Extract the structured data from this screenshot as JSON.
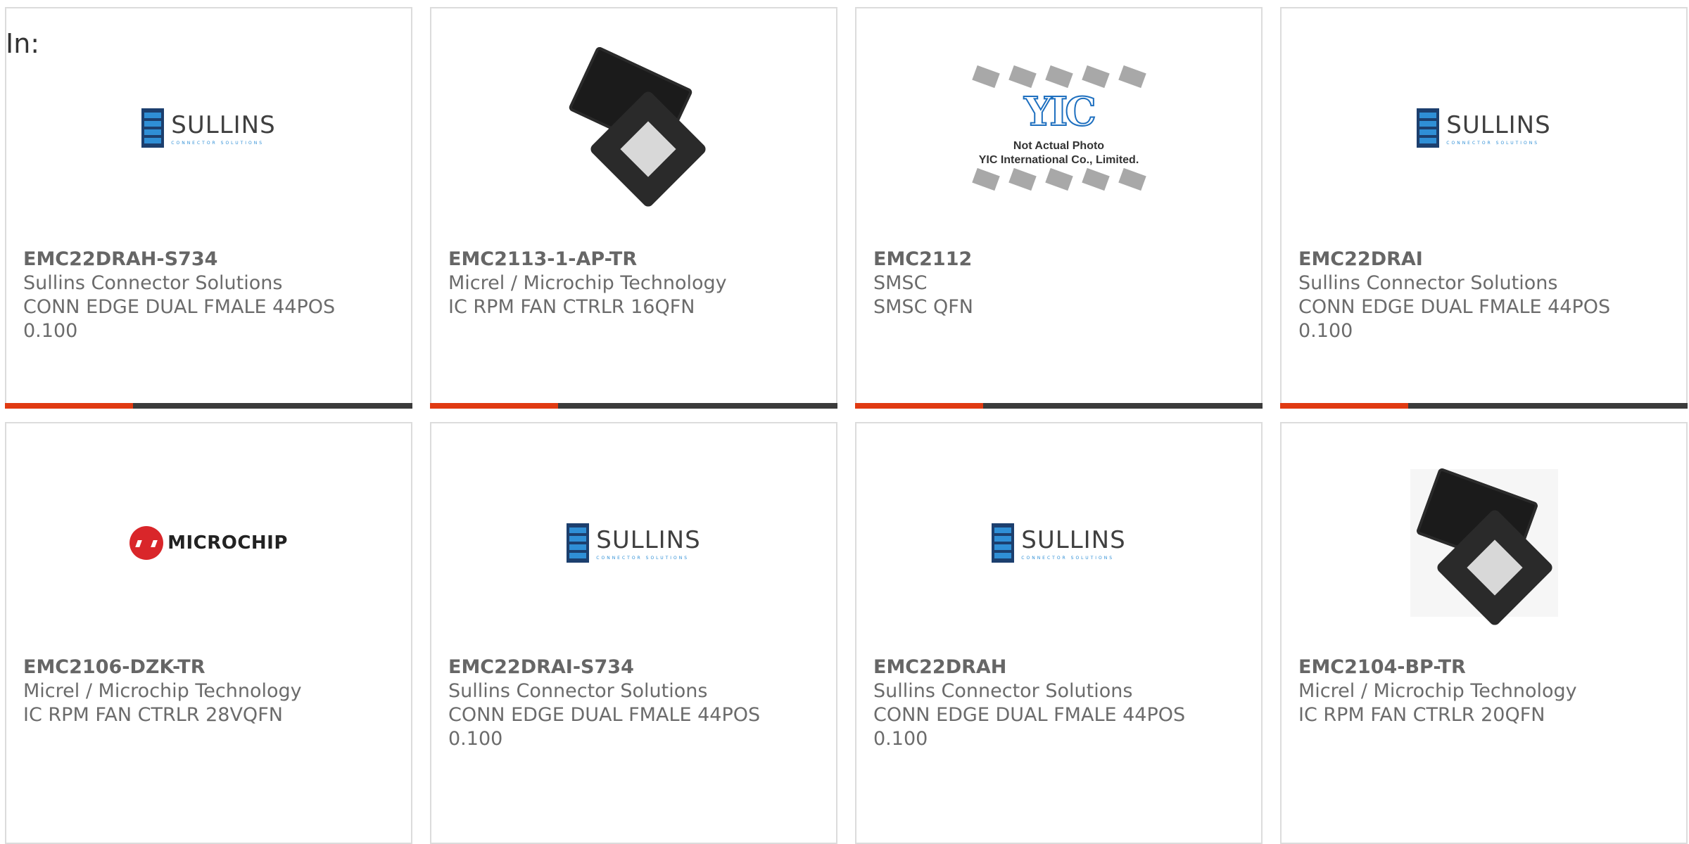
{
  "filter_label": "In:",
  "products": [
    {
      "part": "EMC22DRAH-S734",
      "mfr": "Sullins Connector Solutions",
      "desc": "CONN EDGE DUAL FMALE 44POS",
      "extra": "0.100",
      "image": "sullins-logo"
    },
    {
      "part": "EMC2113-1-AP-TR",
      "mfr": "Micrel / Microchip Technology",
      "desc": "IC RPM FAN CTRLR 16QFN",
      "extra": "",
      "image": "microchip-qfn-chip"
    },
    {
      "part": "EMC2112",
      "mfr": "SMSC",
      "desc": "SMSC QFN",
      "extra": "",
      "image": "yic-placeholder"
    },
    {
      "part": "EMC22DRAI",
      "mfr": "Sullins Connector Solutions",
      "desc": "CONN EDGE DUAL FMALE 44POS",
      "extra": "0.100",
      "image": "sullins-logo"
    },
    {
      "part": "EMC2106-DZK-TR",
      "mfr": "Micrel / Microchip Technology",
      "desc": "IC RPM FAN CTRLR 28VQFN",
      "extra": "",
      "image": "microchip-logo"
    },
    {
      "part": "EMC22DRAI-S734",
      "mfr": "Sullins Connector Solutions",
      "desc": "CONN EDGE DUAL FMALE 44POS",
      "extra": "0.100",
      "image": "sullins-logo"
    },
    {
      "part": "EMC22DRAH",
      "mfr": "Sullins Connector Solutions",
      "desc": "CONN EDGE DUAL FMALE 44POS",
      "extra": "0.100",
      "image": "sullins-logo"
    },
    {
      "part": "EMC2104-BP-TR",
      "mfr": "Micrel / Microchip Technology",
      "desc": "IC RPM FAN CTRLR 20QFN",
      "extra": "",
      "image": "qfn-chip"
    }
  ],
  "logos": {
    "sullins_name": "SULLINS",
    "sullins_tagline": "CONNECTOR SOLUTIONS",
    "microchip_name": "MICROCHIP",
    "yic_logo": "YIC",
    "yic_caption_1": "Not Actual Photo",
    "yic_caption_2": "YIC International Co., Limited."
  },
  "colors": {
    "accent": "#e03a12",
    "bar": "#3b3b3b",
    "border": "#dcdcdc",
    "text": "#6b6b6b"
  }
}
